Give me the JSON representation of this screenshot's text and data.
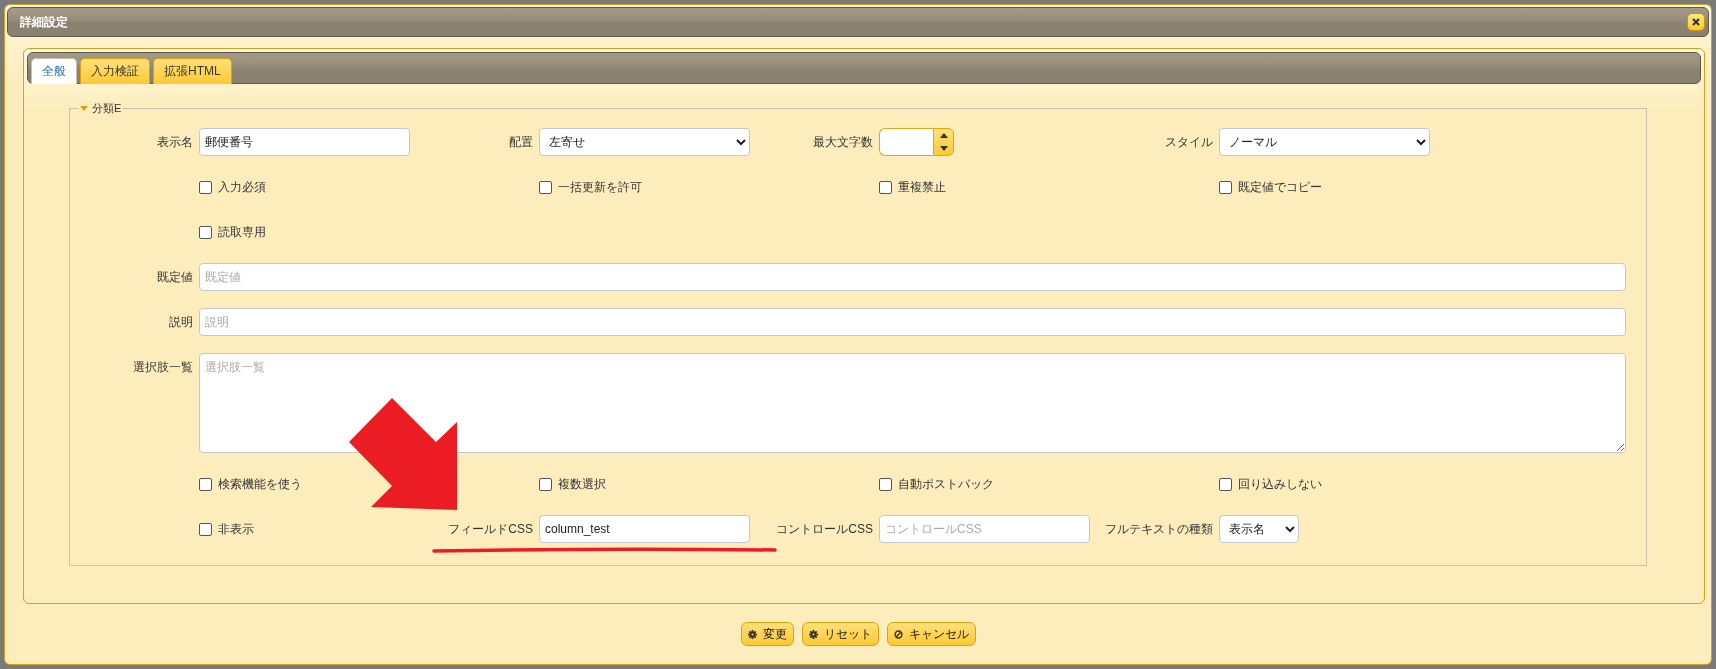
{
  "window": {
    "title": "詳細設定"
  },
  "tabs": [
    {
      "label": "全般",
      "selected": true
    },
    {
      "label": "入力検証",
      "selected": false
    },
    {
      "label": "拡張HTML",
      "selected": false
    }
  ],
  "section": {
    "title": "分類E",
    "expanded": true
  },
  "rows": [
    [
      {
        "kind": "text",
        "label": "表示名",
        "value": "郵便番号"
      },
      {
        "kind": "select",
        "label": "配置",
        "value": "左寄せ"
      },
      {
        "kind": "number",
        "label": "最大文字数"
      },
      {
        "kind": "select",
        "label": "スタイル",
        "value": "ノーマル"
      }
    ],
    [
      {
        "kind": "checkbox",
        "label": "入力必須",
        "checked": false
      },
      {
        "kind": "checkbox",
        "label": "一括更新を許可",
        "checked": false
      },
      {
        "kind": "checkbox",
        "label": "重複禁止",
        "checked": false
      },
      {
        "kind": "checkbox",
        "label": "既定値でコピー",
        "checked": false
      }
    ],
    [
      {
        "kind": "checkbox",
        "label": "読取専用",
        "checked": false
      }
    ],
    [
      {
        "kind": "wide",
        "label": "既定値",
        "placeholder": "既定値"
      }
    ],
    [
      {
        "kind": "wide",
        "label": "説明",
        "placeholder": "説明"
      }
    ],
    [
      {
        "kind": "textarea",
        "label": "選択肢一覧",
        "placeholder": "選択肢一覧"
      }
    ],
    [
      {
        "kind": "checkbox",
        "label": "検索機能を使う",
        "checked": false
      },
      {
        "kind": "checkbox",
        "label": "複数選択",
        "checked": false
      },
      {
        "kind": "checkbox",
        "label": "自動ポストバック",
        "checked": false
      },
      {
        "kind": "checkbox",
        "label": "回り込みしない",
        "checked": false
      }
    ],
    [
      {
        "kind": "checkbox",
        "label": "非表示",
        "checked": false
      },
      {
        "kind": "text",
        "label": "フィールドCSS",
        "value": "column_test"
      },
      {
        "kind": "text",
        "label": "コントロールCSS",
        "placeholder": "コントロールCSS"
      },
      {
        "kind": "compact_select",
        "label": "フルテキストの種類",
        "value": "表示名"
      }
    ]
  ],
  "buttons": [
    {
      "kind": "gear",
      "label": "変更"
    },
    {
      "kind": "gear",
      "label": "リセット"
    },
    {
      "kind": "ban",
      "label": "キャンセル"
    }
  ]
}
